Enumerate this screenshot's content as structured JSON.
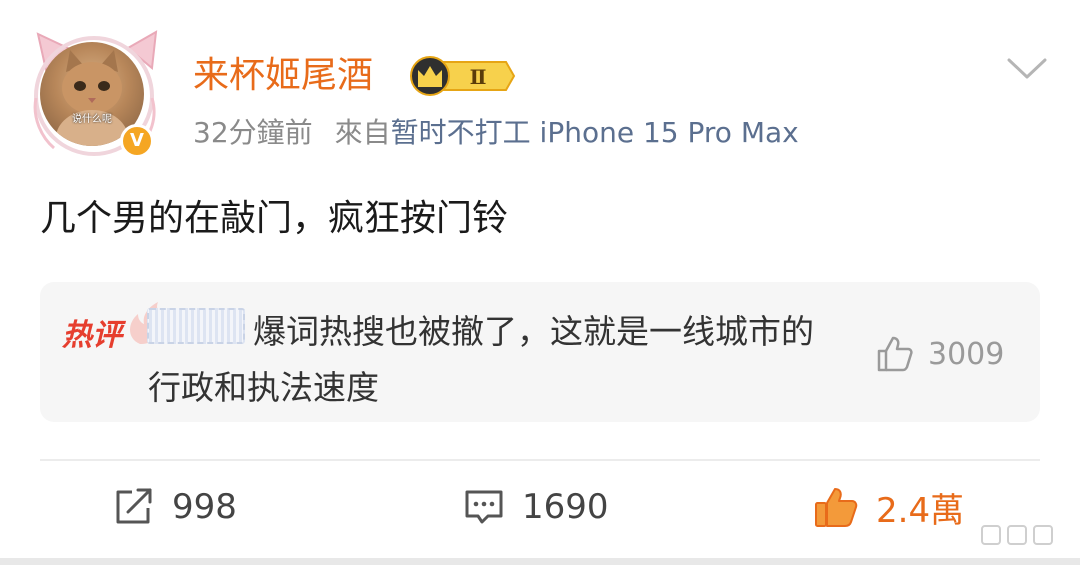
{
  "post": {
    "user": {
      "name": "来杯姬尾酒",
      "avatar_caption": "说什么呢",
      "verified_mark": "V",
      "vip_level": "Ⅱ"
    },
    "meta": {
      "time": "32分鐘前",
      "source_prefix": "來自",
      "source_name": "暂时不打工 iPhone 15 Pro Max"
    },
    "text": "几个男的在敲门，疯狂按门铃"
  },
  "hot_comment": {
    "tag": "热评",
    "text": "爆词热搜也被撤了，这就是一线城市的行政和执法速度",
    "like_count": "3009"
  },
  "actions": {
    "repost_count": "998",
    "comment_count": "1690",
    "like_count": "2.4萬"
  },
  "colors": {
    "username": "#e86b1a",
    "source": "#5b6f8f",
    "hot_tag": "#e63e2e",
    "liked": "#e86b1a"
  },
  "icons": [
    "chevron-down-icon",
    "thumb-up-icon",
    "repost-icon",
    "comment-icon",
    "flame-icon",
    "crown-icon"
  ]
}
